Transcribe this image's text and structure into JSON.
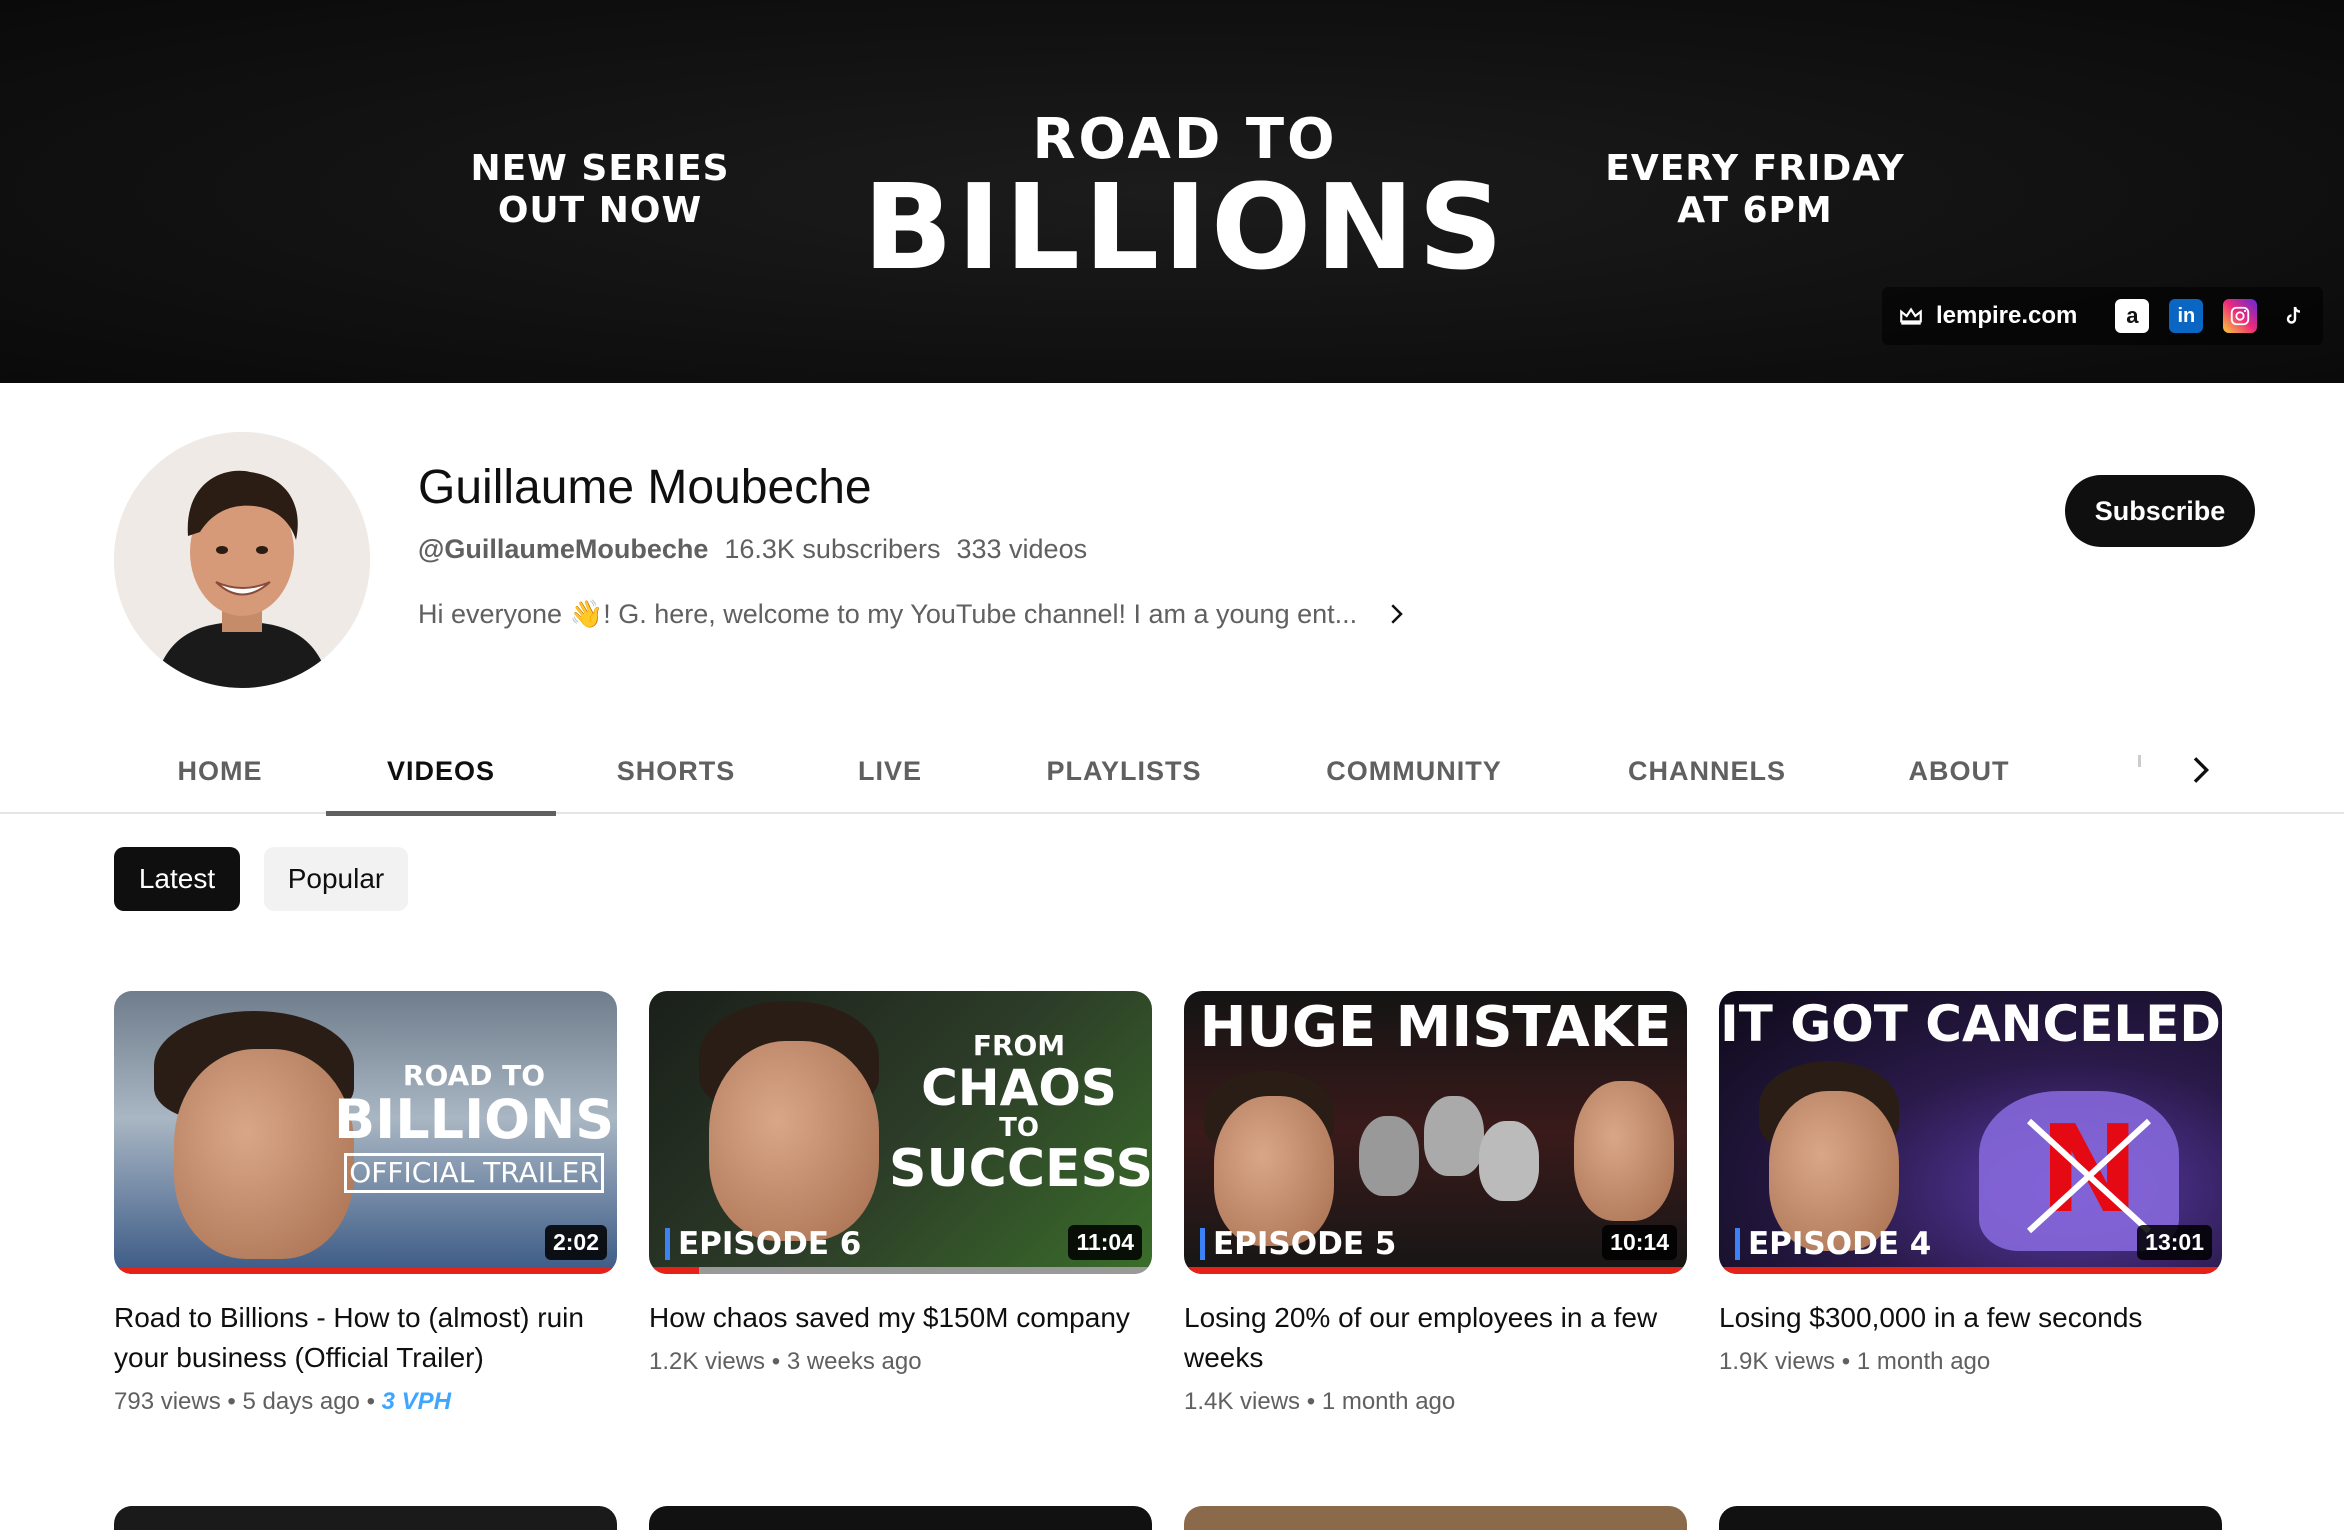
{
  "banner": {
    "left_line1": "NEW SERIES",
    "left_line2": "OUT NOW",
    "center_top": "ROAD TO",
    "center_big": "BILLIONS",
    "right_line1": "EVERY FRIDAY",
    "right_line2": "AT 6PM",
    "link_label": "lempire.com",
    "social_icons": [
      "amazon-icon",
      "linkedin-icon",
      "instagram-icon",
      "tiktok-icon"
    ]
  },
  "channel": {
    "name": "Guillaume Moubeche",
    "handle": "@GuillaumeMoubeche",
    "subscribers": "16.3K subscribers",
    "videos": "333 videos",
    "description": "Hi everyone 👋! G. here, welcome to my YouTube channel! I am a young ent...",
    "subscribe_label": "Subscribe"
  },
  "tabs": [
    {
      "label": "HOME",
      "active": false
    },
    {
      "label": "VIDEOS",
      "active": true
    },
    {
      "label": "SHORTS",
      "active": false
    },
    {
      "label": "LIVE",
      "active": false
    },
    {
      "label": "PLAYLISTS",
      "active": false
    },
    {
      "label": "COMMUNITY",
      "active": false
    },
    {
      "label": "CHANNELS",
      "active": false
    },
    {
      "label": "ABOUT",
      "active": false
    }
  ],
  "chips": [
    {
      "label": "Latest",
      "selected": true
    },
    {
      "label": "Popular",
      "selected": false
    }
  ],
  "videos": [
    {
      "thumb_text_1": "ROAD TO",
      "thumb_text_2": "BILLIONS",
      "thumb_text_3": "OFFICIAL TRAILER",
      "duration": "2:02",
      "title": "Road to Billions - How to (almost) ruin your business (Official Trailer)",
      "views": "793 views",
      "age": "5 days ago",
      "extra": "3 VPH"
    },
    {
      "thumb_text_1": "FROM",
      "thumb_text_2": "CHAOS",
      "thumb_text_3": "TO",
      "thumb_text_4": "SUCCESS",
      "episode": "EPISODE 6",
      "duration": "11:04",
      "title": "How chaos saved my $150M company",
      "views": "1.2K views",
      "age": "3 weeks ago"
    },
    {
      "thumb_text_1": "HUGE MISTAKE",
      "episode": "EPISODE 5",
      "duration": "10:14",
      "title": "Losing 20% of our employees in a few weeks",
      "views": "1.4K views",
      "age": "1 month ago"
    },
    {
      "thumb_text_1": "IT GOT CANCELED",
      "thumb_text_2": "N",
      "episode": "EPISODE 4",
      "duration": "13:01",
      "title": "Losing $300,000 in a few seconds",
      "views": "1.9K views",
      "age": "1 month ago"
    }
  ]
}
